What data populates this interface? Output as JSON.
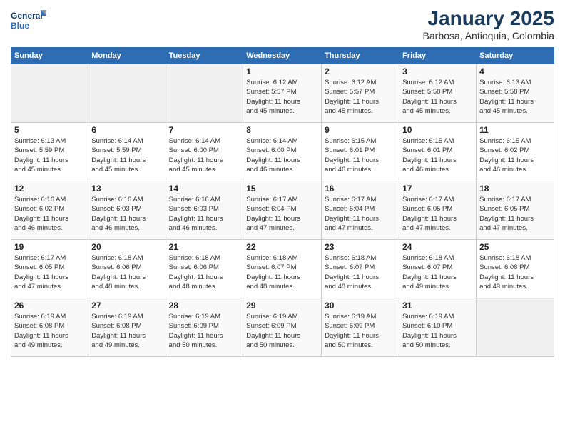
{
  "logo": {
    "line1": "General",
    "line2": "Blue"
  },
  "header": {
    "title": "January 2025",
    "subtitle": "Barbosa, Antioquia, Colombia"
  },
  "weekdays": [
    "Sunday",
    "Monday",
    "Tuesday",
    "Wednesday",
    "Thursday",
    "Friday",
    "Saturday"
  ],
  "weeks": [
    [
      {
        "day": "",
        "info": ""
      },
      {
        "day": "",
        "info": ""
      },
      {
        "day": "",
        "info": ""
      },
      {
        "day": "1",
        "info": "Sunrise: 6:12 AM\nSunset: 5:57 PM\nDaylight: 11 hours\nand 45 minutes."
      },
      {
        "day": "2",
        "info": "Sunrise: 6:12 AM\nSunset: 5:57 PM\nDaylight: 11 hours\nand 45 minutes."
      },
      {
        "day": "3",
        "info": "Sunrise: 6:12 AM\nSunset: 5:58 PM\nDaylight: 11 hours\nand 45 minutes."
      },
      {
        "day": "4",
        "info": "Sunrise: 6:13 AM\nSunset: 5:58 PM\nDaylight: 11 hours\nand 45 minutes."
      }
    ],
    [
      {
        "day": "5",
        "info": "Sunrise: 6:13 AM\nSunset: 5:59 PM\nDaylight: 11 hours\nand 45 minutes."
      },
      {
        "day": "6",
        "info": "Sunrise: 6:14 AM\nSunset: 5:59 PM\nDaylight: 11 hours\nand 45 minutes."
      },
      {
        "day": "7",
        "info": "Sunrise: 6:14 AM\nSunset: 6:00 PM\nDaylight: 11 hours\nand 45 minutes."
      },
      {
        "day": "8",
        "info": "Sunrise: 6:14 AM\nSunset: 6:00 PM\nDaylight: 11 hours\nand 46 minutes."
      },
      {
        "day": "9",
        "info": "Sunrise: 6:15 AM\nSunset: 6:01 PM\nDaylight: 11 hours\nand 46 minutes."
      },
      {
        "day": "10",
        "info": "Sunrise: 6:15 AM\nSunset: 6:01 PM\nDaylight: 11 hours\nand 46 minutes."
      },
      {
        "day": "11",
        "info": "Sunrise: 6:15 AM\nSunset: 6:02 PM\nDaylight: 11 hours\nand 46 minutes."
      }
    ],
    [
      {
        "day": "12",
        "info": "Sunrise: 6:16 AM\nSunset: 6:02 PM\nDaylight: 11 hours\nand 46 minutes."
      },
      {
        "day": "13",
        "info": "Sunrise: 6:16 AM\nSunset: 6:03 PM\nDaylight: 11 hours\nand 46 minutes."
      },
      {
        "day": "14",
        "info": "Sunrise: 6:16 AM\nSunset: 6:03 PM\nDaylight: 11 hours\nand 46 minutes."
      },
      {
        "day": "15",
        "info": "Sunrise: 6:17 AM\nSunset: 6:04 PM\nDaylight: 11 hours\nand 47 minutes."
      },
      {
        "day": "16",
        "info": "Sunrise: 6:17 AM\nSunset: 6:04 PM\nDaylight: 11 hours\nand 47 minutes."
      },
      {
        "day": "17",
        "info": "Sunrise: 6:17 AM\nSunset: 6:05 PM\nDaylight: 11 hours\nand 47 minutes."
      },
      {
        "day": "18",
        "info": "Sunrise: 6:17 AM\nSunset: 6:05 PM\nDaylight: 11 hours\nand 47 minutes."
      }
    ],
    [
      {
        "day": "19",
        "info": "Sunrise: 6:17 AM\nSunset: 6:05 PM\nDaylight: 11 hours\nand 47 minutes."
      },
      {
        "day": "20",
        "info": "Sunrise: 6:18 AM\nSunset: 6:06 PM\nDaylight: 11 hours\nand 48 minutes."
      },
      {
        "day": "21",
        "info": "Sunrise: 6:18 AM\nSunset: 6:06 PM\nDaylight: 11 hours\nand 48 minutes."
      },
      {
        "day": "22",
        "info": "Sunrise: 6:18 AM\nSunset: 6:07 PM\nDaylight: 11 hours\nand 48 minutes."
      },
      {
        "day": "23",
        "info": "Sunrise: 6:18 AM\nSunset: 6:07 PM\nDaylight: 11 hours\nand 48 minutes."
      },
      {
        "day": "24",
        "info": "Sunrise: 6:18 AM\nSunset: 6:07 PM\nDaylight: 11 hours\nand 49 minutes."
      },
      {
        "day": "25",
        "info": "Sunrise: 6:18 AM\nSunset: 6:08 PM\nDaylight: 11 hours\nand 49 minutes."
      }
    ],
    [
      {
        "day": "26",
        "info": "Sunrise: 6:19 AM\nSunset: 6:08 PM\nDaylight: 11 hours\nand 49 minutes."
      },
      {
        "day": "27",
        "info": "Sunrise: 6:19 AM\nSunset: 6:08 PM\nDaylight: 11 hours\nand 49 minutes."
      },
      {
        "day": "28",
        "info": "Sunrise: 6:19 AM\nSunset: 6:09 PM\nDaylight: 11 hours\nand 50 minutes."
      },
      {
        "day": "29",
        "info": "Sunrise: 6:19 AM\nSunset: 6:09 PM\nDaylight: 11 hours\nand 50 minutes."
      },
      {
        "day": "30",
        "info": "Sunrise: 6:19 AM\nSunset: 6:09 PM\nDaylight: 11 hours\nand 50 minutes."
      },
      {
        "day": "31",
        "info": "Sunrise: 6:19 AM\nSunset: 6:10 PM\nDaylight: 11 hours\nand 50 minutes."
      },
      {
        "day": "",
        "info": ""
      }
    ]
  ]
}
